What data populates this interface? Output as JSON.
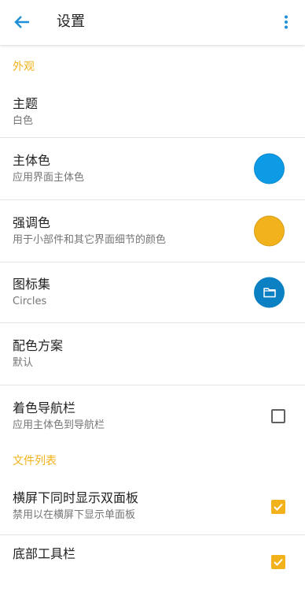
{
  "appbar": {
    "title": "设置",
    "back_icon": "arrow-back-icon",
    "more_icon": "more-vert-icon"
  },
  "colors": {
    "accent": "#f2b21b",
    "primary": "#0d9be6",
    "icon_set_bg": "#0b81c4",
    "back_icon": "#1c8fd8",
    "more_icon": "#1c8fd8"
  },
  "sections": {
    "appearance": {
      "header": "外观"
    },
    "file_list": {
      "header": "文件列表"
    }
  },
  "settings": {
    "theme": {
      "title": "主题",
      "summary": "白色"
    },
    "primary_color": {
      "title": "主体色",
      "summary": "应用界面主体色",
      "color": "#0d9be6"
    },
    "accent_color": {
      "title": "强调色",
      "summary": "用于小部件和其它界面细节的颜色",
      "color": "#f2b21b"
    },
    "icon_set": {
      "title": "图标集",
      "summary": "Circles",
      "icon": "folder-icon"
    },
    "color_scheme": {
      "title": "配色方案",
      "summary": "默认"
    },
    "colored_navbar": {
      "title": "着色导航栏",
      "summary": "应用主体色到导航栏",
      "checked": false
    },
    "dual_pane": {
      "title": "横屏下同时显示双面板",
      "summary": "禁用以在横屏下显示单面板",
      "checked": true
    },
    "bottom_toolbar": {
      "title": "底部工具栏",
      "checked": true
    }
  }
}
